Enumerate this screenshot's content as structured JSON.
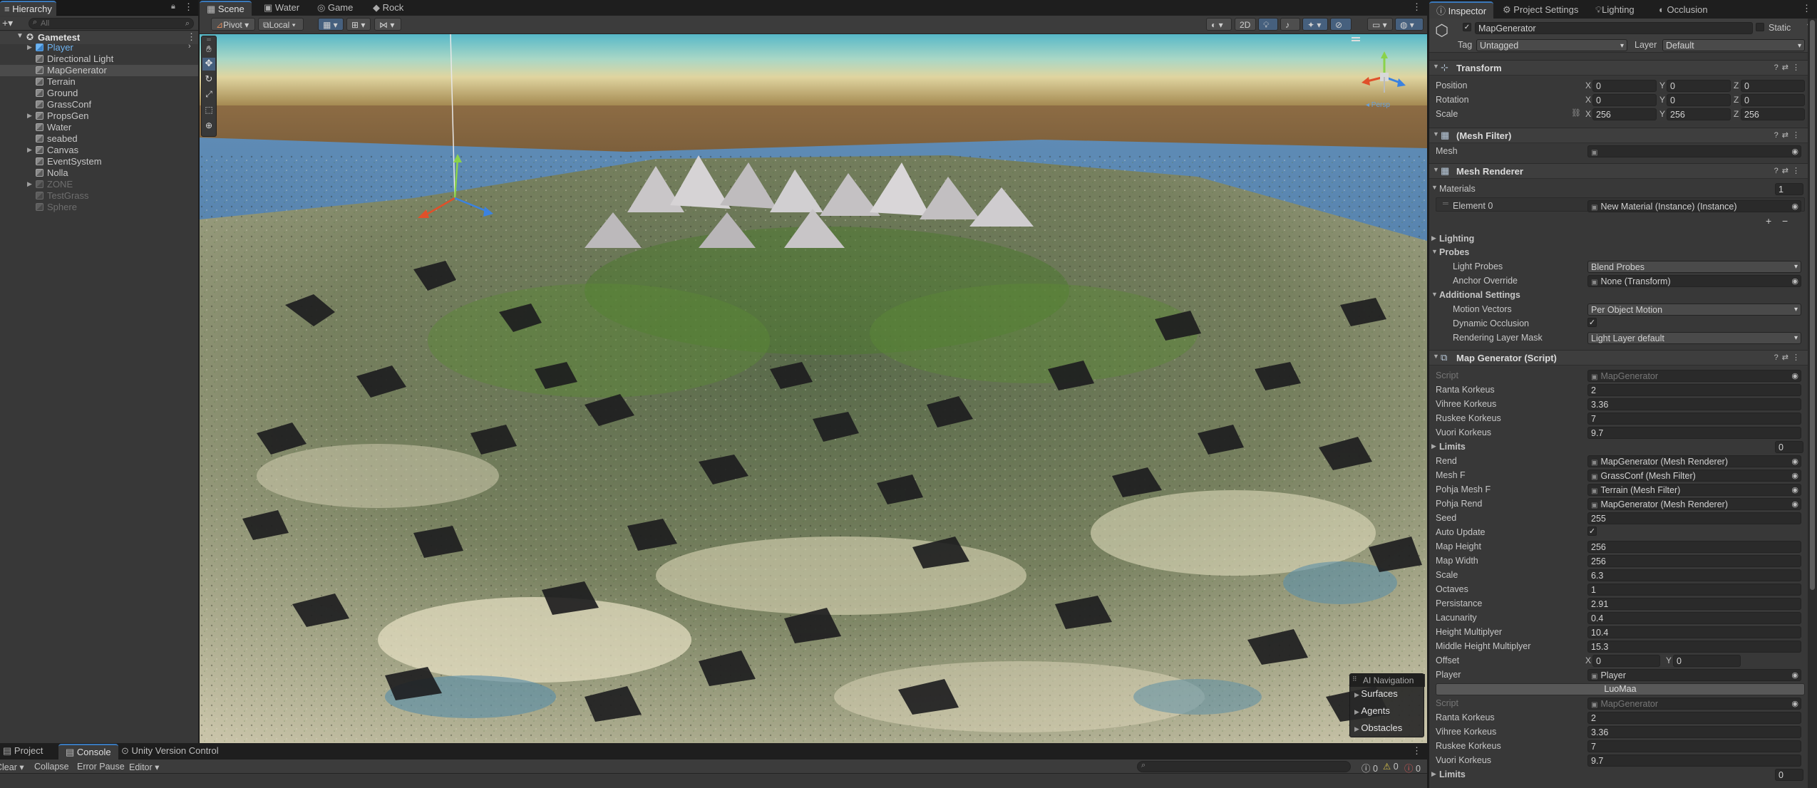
{
  "hierarchy": {
    "tab_label": "Hierarchy",
    "search_placeholder": "All",
    "scene_name": "Gametest",
    "items": [
      {
        "label": "Player",
        "fold": "▶",
        "blue": true,
        "dim": false
      },
      {
        "label": "Directional Light",
        "fold": "",
        "blue": false,
        "dim": false
      },
      {
        "label": "MapGenerator",
        "fold": "",
        "blue": false,
        "dim": false
      },
      {
        "label": "Terrain",
        "fold": "",
        "blue": false,
        "dim": false
      },
      {
        "label": "Ground",
        "fold": "",
        "blue": false,
        "dim": false
      },
      {
        "label": "GrassConf",
        "fold": "",
        "blue": false,
        "dim": false
      },
      {
        "label": "PropsGen",
        "fold": "▶",
        "blue": false,
        "dim": false
      },
      {
        "label": "Water",
        "fold": "",
        "blue": false,
        "dim": false
      },
      {
        "label": "seabed",
        "fold": "",
        "blue": false,
        "dim": false
      },
      {
        "label": "Canvas",
        "fold": "▶",
        "blue": false,
        "dim": false
      },
      {
        "label": "EventSystem",
        "fold": "",
        "blue": false,
        "dim": false
      },
      {
        "label": "Nolla",
        "fold": "",
        "blue": false,
        "dim": false
      },
      {
        "label": "ZONE",
        "fold": "▶",
        "blue": false,
        "dim": true
      },
      {
        "label": "TestGrass",
        "fold": "",
        "blue": false,
        "dim": true
      },
      {
        "label": "Sphere",
        "fold": "",
        "blue": false,
        "dim": true
      }
    ]
  },
  "scene_tabs": [
    "Scene",
    "Water",
    "Game",
    "Rock"
  ],
  "scene_toolbar": {
    "pivot": "Pivot",
    "local": "Local",
    "mode_2d": "2D"
  },
  "ai_navigation": {
    "title": "AI Navigation",
    "items": [
      "Surfaces",
      "Agents",
      "Obstacles"
    ]
  },
  "bottom": {
    "tabs": [
      "Project",
      "Console",
      "Unity Version Control"
    ],
    "toolbar": [
      "Clear",
      "Collapse",
      "Error Pause",
      "Editor"
    ],
    "counts": [
      "0",
      "0",
      "0"
    ]
  },
  "inspector": {
    "tabs": [
      "Inspector",
      "Project Settings",
      "Lighting",
      "Occlusion"
    ],
    "object_name": "MapGenerator",
    "static_label": "Static",
    "tag_label": "Tag",
    "tag_value": "Untagged",
    "layer_label": "Layer",
    "layer_value": "Default",
    "transform": {
      "title": "Transform",
      "position_label": "Position",
      "position": [
        "0",
        "0",
        "0"
      ],
      "rotation_label": "Rotation",
      "rotation": [
        "0",
        "0",
        "0"
      ],
      "scale_label": "Scale",
      "scale": [
        "256",
        "256",
        "256"
      ]
    },
    "mesh_filter": {
      "title": "(Mesh Filter)",
      "mesh_label": "Mesh"
    },
    "mesh_renderer": {
      "title": "Mesh Renderer",
      "materials_label": "Materials",
      "materials_count": "1",
      "element_label": "Element 0",
      "element_value": "New Material (Instance) (Instance)",
      "lighting_label": "Lighting",
      "probes_label": "Probes",
      "light_probes_label": "Light Probes",
      "light_probes_value": "Blend Probes",
      "anchor_label": "Anchor Override",
      "anchor_value": "None (Transform)",
      "additional_label": "Additional Settings",
      "motion_label": "Motion Vectors",
      "motion_value": "Per Object Motion",
      "dyn_occ_label": "Dynamic Occlusion",
      "rlm_label": "Rendering Layer Mask",
      "rlm_value": "Light Layer default"
    },
    "script1": {
      "title": "Map Generator (Script)",
      "fields": [
        {
          "label": "Script",
          "value": "MapGenerator",
          "kind": "ref",
          "dim": true
        },
        {
          "label": "Ranta Korkeus",
          "value": "2",
          "kind": "text"
        },
        {
          "label": "Vihree Korkeus",
          "value": "3.36",
          "kind": "text"
        },
        {
          "label": "Ruskee Korkeus",
          "value": "7",
          "kind": "text"
        },
        {
          "label": "Vuori Korkeus",
          "value": "9.7",
          "kind": "text"
        },
        {
          "label": "Limits",
          "value": "0",
          "kind": "fold"
        },
        {
          "label": "Rend",
          "value": "MapGenerator (Mesh Renderer)",
          "kind": "ref"
        },
        {
          "label": "Mesh F",
          "value": "GrassConf (Mesh Filter)",
          "kind": "ref"
        },
        {
          "label": "Pohja Mesh F",
          "value": "Terrain (Mesh Filter)",
          "kind": "ref"
        },
        {
          "label": "Pohja Rend",
          "value": "MapGenerator (Mesh Renderer)",
          "kind": "ref"
        },
        {
          "label": "Seed",
          "value": "255",
          "kind": "text"
        },
        {
          "label": "Auto Update",
          "value": "✓",
          "kind": "check"
        },
        {
          "label": "Map Height",
          "value": "256",
          "kind": "text"
        },
        {
          "label": "Map Width",
          "value": "256",
          "kind": "text"
        },
        {
          "label": "Scale",
          "value": "6.3",
          "kind": "text"
        },
        {
          "label": "Octaves",
          "value": "1",
          "kind": "text"
        },
        {
          "label": "Persistance",
          "value": "2.91",
          "kind": "text"
        },
        {
          "label": "Lacunarity",
          "value": "0.4",
          "kind": "text"
        },
        {
          "label": "Height Multiplyer",
          "value": "10.4",
          "kind": "text"
        },
        {
          "label": "Middle Height Multiplyer",
          "value": "15.3",
          "kind": "text"
        }
      ],
      "offset_label": "Offset",
      "offset": [
        "0",
        "0"
      ],
      "player_label": "Player",
      "player_value": "Player",
      "button_label": "LuoMaa"
    },
    "script2": {
      "fields": [
        {
          "label": "Script",
          "value": "MapGenerator",
          "kind": "ref",
          "dim": true
        },
        {
          "label": "Ranta Korkeus",
          "value": "2",
          "kind": "text"
        },
        {
          "label": "Vihree Korkeus",
          "value": "3.36",
          "kind": "text"
        },
        {
          "label": "Ruskee Korkeus",
          "value": "7",
          "kind": "text"
        },
        {
          "label": "Vuori Korkeus",
          "value": "9.7",
          "kind": "text"
        },
        {
          "label": "Limits",
          "value": "0",
          "kind": "fold"
        }
      ]
    }
  }
}
